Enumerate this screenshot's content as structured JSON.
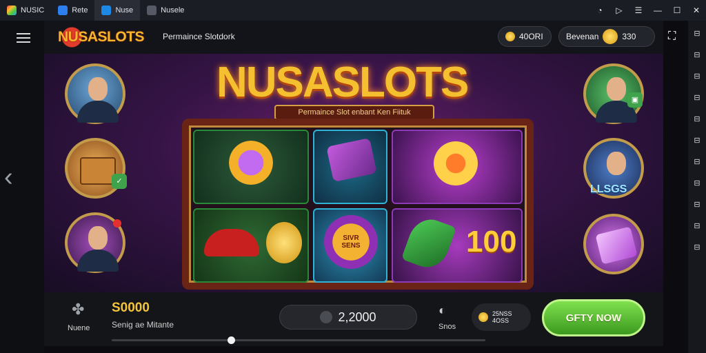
{
  "titlebar": {
    "tabs": [
      {
        "label": "NUSIC",
        "active": false
      },
      {
        "label": "Rete",
        "active": false
      },
      {
        "label": "Nuse",
        "active": true
      },
      {
        "label": "Nusele",
        "active": false
      }
    ],
    "window_controls": [
      "help-icon",
      "play-icon",
      "menu-icon",
      "minimize-icon",
      "maximize-icon",
      "close-icon"
    ]
  },
  "header": {
    "logo": "NUSASLOTS",
    "subtitle": "Permaince Slotdork",
    "coins_pill": "40ORI",
    "balance_pill_label": "Bevenan",
    "balance_pill_value": "330"
  },
  "game": {
    "title": "NUSASLOTS",
    "banner": "Permaince Slot enbant Ken Fiituk",
    "reel_text_bonus": "SIVR SENS",
    "reel_text_100": "100",
    "lucky_label": "LLSGS"
  },
  "bottom": {
    "menu_label": "Nuene",
    "balance": "S0000",
    "balance_sub": "Senig ae Mitante",
    "bet_value": "2,2000",
    "sound_label": "Snos",
    "chip_line1": "25NSS",
    "chip_line2": "4OSS",
    "spin_label": "GFTY NOW",
    "progress": 0.32
  },
  "colors": {
    "accent_gold": "#f5c02f",
    "spin_green": "#5cc130",
    "background": "#0c0c10"
  }
}
